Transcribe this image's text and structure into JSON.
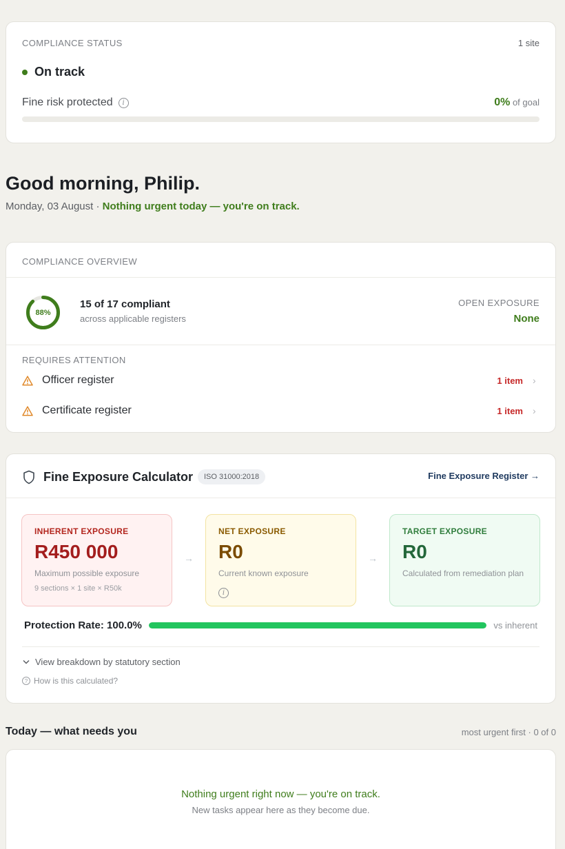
{
  "status": {
    "heading": "COMPLIANCE STATUS",
    "site_count": "1 site",
    "state": "On track",
    "risk_label": "Fine risk protected",
    "risk_value": "0%",
    "risk_suffix": "of goal",
    "risk_progress_fraction": 0
  },
  "greeting": {
    "title": "Good morning, Philip.",
    "date": "Monday, 03 August · ",
    "message": "Nothing urgent today — you're on track."
  },
  "overview": {
    "heading": "COMPLIANCE OVERVIEW",
    "percent_label": "88%",
    "percent_value": 88,
    "compliant_title": "15 of 17 compliant",
    "compliant_sub": "across applicable registers",
    "exposure_label": "OPEN EXPOSURE",
    "exposure_value": "None",
    "attention_heading": "REQUIRES ATTENTION",
    "attention_items": [
      {
        "name": "Officer register",
        "count": "1 item"
      },
      {
        "name": "Certificate register",
        "count": "1 item"
      }
    ]
  },
  "calculator": {
    "title": "Fine Exposure Calculator",
    "badge": "ISO 31000:2018",
    "register_link": "Fine Exposure Register →",
    "inherent": {
      "label": "INHERENT EXPOSURE",
      "value": "R450 000",
      "sub": "Maximum possible exposure",
      "note": "9 sections × 1 site × R50k"
    },
    "net": {
      "label": "NET EXPOSURE",
      "value": "R0",
      "sub": "Current known exposure"
    },
    "target": {
      "label": "TARGET EXPOSURE",
      "value": "R0",
      "sub": "Calculated from remediation plan"
    },
    "rate_label": "Protection Rate: 100.0%",
    "rate_fraction": 1.0,
    "rate_vs": "vs inherent",
    "breakdown_label": "View breakdown by statutory section",
    "how_label": "How is this calculated?"
  },
  "today": {
    "title": "Today — what needs you",
    "meta": "most urgent first · 0 of 0",
    "empty_main": "Nothing urgent right now — you're on track.",
    "empty_sub": "New tasks appear here as they become due."
  },
  "colors": {
    "brand_green": "#3f7d1c",
    "alert_red": "#c62828",
    "progress_green": "#22c55e"
  }
}
